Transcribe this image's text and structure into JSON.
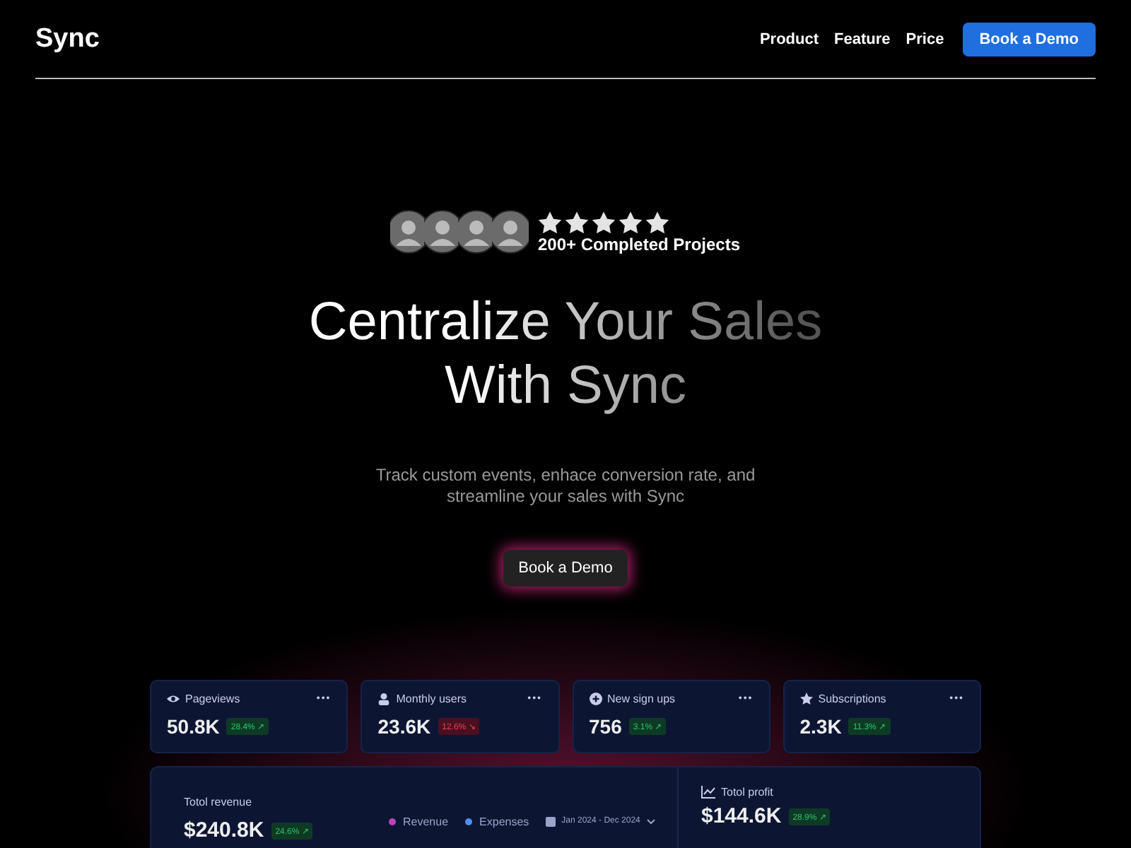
{
  "header": {
    "logo": "Sync",
    "nav": [
      "Product",
      "Feature",
      "Price"
    ],
    "cta": "Book a Demo"
  },
  "hero": {
    "stars": 5,
    "proof": "200+ Completed Projects",
    "title_lines": [
      "Centralize Your Sales",
      "With Sync"
    ],
    "subtitle": "Track custom events, enhace conversion rate, and streamline your sales with Sync",
    "cta": "Book a Demo"
  },
  "stat_cards": [
    {
      "label": "Pageviews",
      "value": "50.8K",
      "change": "28.4% ↗",
      "kind": "up",
      "menu": "•••"
    },
    {
      "label": "Monthly users",
      "value": "23.6K",
      "change": "12.6% ↘",
      "kind": "down",
      "menu": "•••"
    },
    {
      "label": "New sign ups",
      "value": "756",
      "change": "3.1% ↗",
      "kind": "up",
      "menu": "•••"
    },
    {
      "label": "Subscriptions",
      "value": "2.3K",
      "change": "11.3% ↗",
      "kind": "up",
      "menu": "•••"
    }
  ],
  "revenue_panel": {
    "label": "Totol revenue",
    "value": "$240.8K",
    "change": "24.6% ↗",
    "legend": [
      {
        "label": "Revenue",
        "color": "#c040c0"
      },
      {
        "label": "Expenses",
        "color": "#4f8ff0"
      }
    ],
    "date_range": "Jan 2024 - Dec 2024"
  },
  "profit_panel": {
    "label": "Totol profit",
    "value": "$144.6K",
    "change": "28.9% ↗"
  }
}
